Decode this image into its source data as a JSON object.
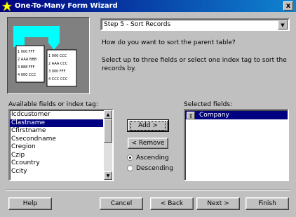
{
  "window": {
    "title": "One-To-Many Form Wizard",
    "close_glyph": "x",
    "icon": "wizard-star-icon"
  },
  "step_combo": {
    "value": "Step 5 - Sort Records",
    "arrow": "▼"
  },
  "instructions": {
    "question": "How do you want to sort the parent table?",
    "detail": "Select up to three fields or select one index tag to sort the records by."
  },
  "illustration": {
    "left_rows": [
      "1 000 FFF",
      "2 AAA BBB",
      "3 888 FFF",
      "4 000 CCC"
    ],
    "right_rows": [
      "1 000 CCC",
      "2 AAA CCC",
      "3 000 FFF",
      "4 CCC CCC"
    ]
  },
  "available": {
    "label": "Available fields or index tag:",
    "items": [
      "Icdcustomer",
      "Clastname",
      "Cfirstname",
      "Csecondname",
      "Cregion",
      "Czip",
      "Ccountry",
      "Ccity"
    ],
    "selected_index": 1
  },
  "buttons": {
    "add": "Add >",
    "remove": "< Remove",
    "help": "Help",
    "cancel": "Cancel",
    "back": "< Back",
    "next": "Next >",
    "finish": "Finish"
  },
  "sort_order": {
    "ascending": "Ascending",
    "descending": "Descending",
    "selected": "ascending"
  },
  "selected_fields": {
    "label": "Selected fields:",
    "items": [
      "Company"
    ],
    "item_marker": "⇕"
  }
}
